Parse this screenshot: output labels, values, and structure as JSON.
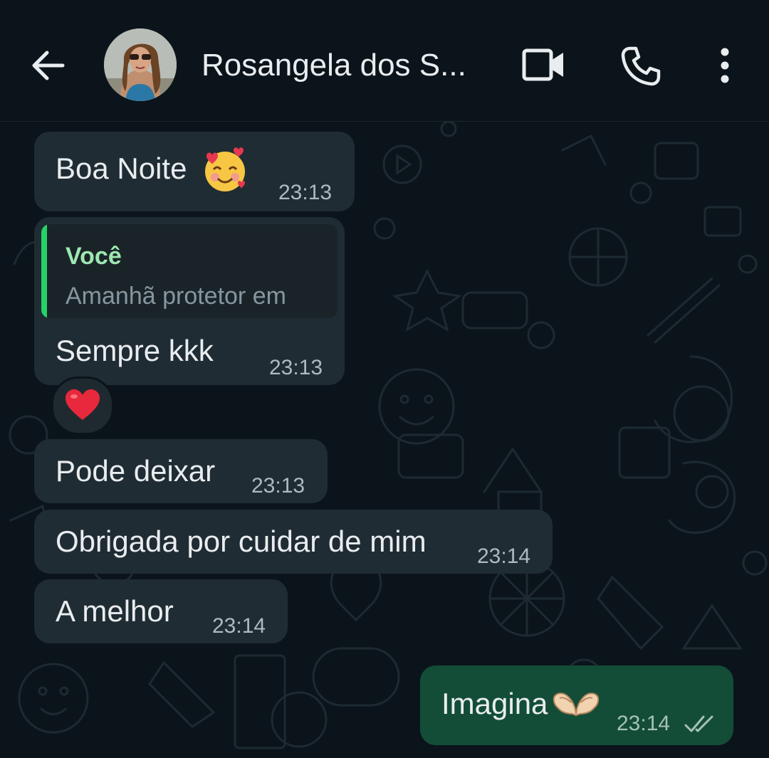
{
  "header": {
    "contact_name": "Rosangela dos S...",
    "icons": [
      "back-arrow-icon",
      "video-call-icon",
      "phone-icon",
      "more-options-icon"
    ]
  },
  "messages": [
    {
      "id": "m1",
      "direction": "incoming",
      "text": "Boa Noite",
      "emoji": "smiling-face-with-hearts",
      "time": "23:13"
    },
    {
      "id": "m2",
      "direction": "incoming",
      "quote": {
        "author": "Você",
        "text": "Amanhã protetor em"
      },
      "text": "Sempre kkk",
      "time": "23:13",
      "reaction": "red-heart"
    },
    {
      "id": "m3",
      "direction": "incoming",
      "text": "Pode deixar",
      "time": "23:13"
    },
    {
      "id": "m4",
      "direction": "incoming",
      "text": "Obrigada por cuidar de mim",
      "time": "23:14"
    },
    {
      "id": "m5",
      "direction": "incoming",
      "text": "A melhor",
      "time": "23:14"
    },
    {
      "id": "m6",
      "direction": "outgoing",
      "text": "Imagina",
      "emoji": "heart-hands",
      "time": "23:14",
      "status": "read"
    }
  ],
  "colors": {
    "background": "#0b141a",
    "incoming_bubble": "#202c33",
    "outgoing_bubble": "#134d37",
    "accent": "#25d366",
    "read_ticks": "#a6c2b5"
  }
}
